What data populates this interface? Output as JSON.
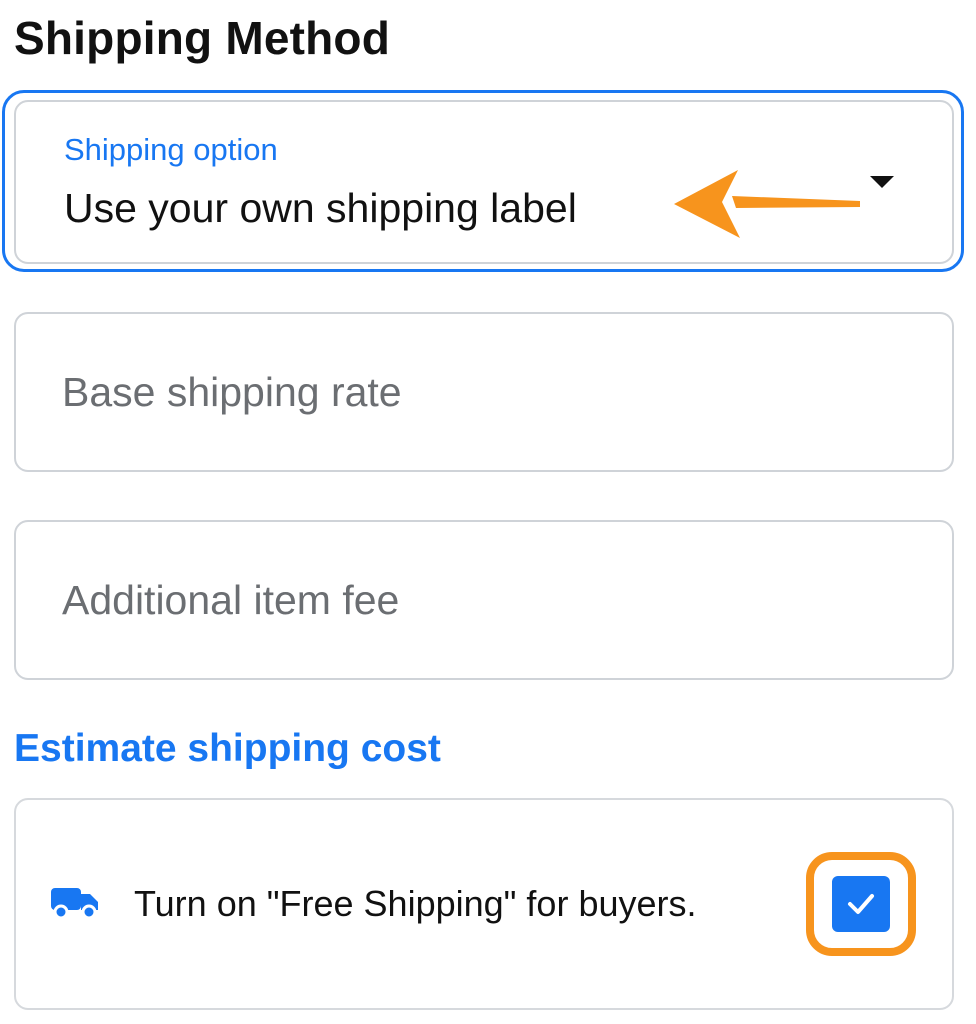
{
  "section": {
    "title": "Shipping Method"
  },
  "shipping_option": {
    "label": "Shipping option",
    "value": "Use your own shipping label",
    "icon": "caret-down-icon"
  },
  "fields": {
    "base_rate_placeholder": "Base shipping rate",
    "additional_fee_placeholder": "Additional item fee"
  },
  "estimate": {
    "link_text": "Estimate shipping cost"
  },
  "free_shipping": {
    "icon": "truck-icon",
    "text": "Turn on \"Free Shipping\" for buyers.",
    "checked": true
  },
  "colors": {
    "accent": "#1877f2",
    "annotation": "#f7941d",
    "field_border": "#cfd3d8"
  }
}
